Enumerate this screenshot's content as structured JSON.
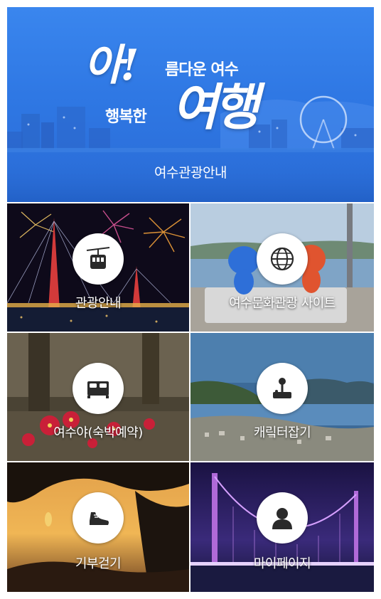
{
  "banner": {
    "logo_a": "아!",
    "logo_line1": "름다운 여수",
    "logo_line2": "행복한",
    "logo_trip": "여행",
    "title": "여수관광안내"
  },
  "menu": [
    {
      "label": "관광안내",
      "icon": "cable-car-icon"
    },
    {
      "label": "여수문화관광 사이트",
      "icon": "globe-icon"
    },
    {
      "label": "여수야(숙박예약)",
      "icon": "bed-icon"
    },
    {
      "label": "캐릭터잡기",
      "icon": "joystick-icon"
    },
    {
      "label": "기부걷기",
      "icon": "shoe-icon"
    },
    {
      "label": "마이페이지",
      "icon": "user-icon"
    }
  ],
  "colors": {
    "banner_blue": "#2f78e4",
    "icon_dark": "#2a2a2a",
    "label_text": "#ffffff"
  }
}
